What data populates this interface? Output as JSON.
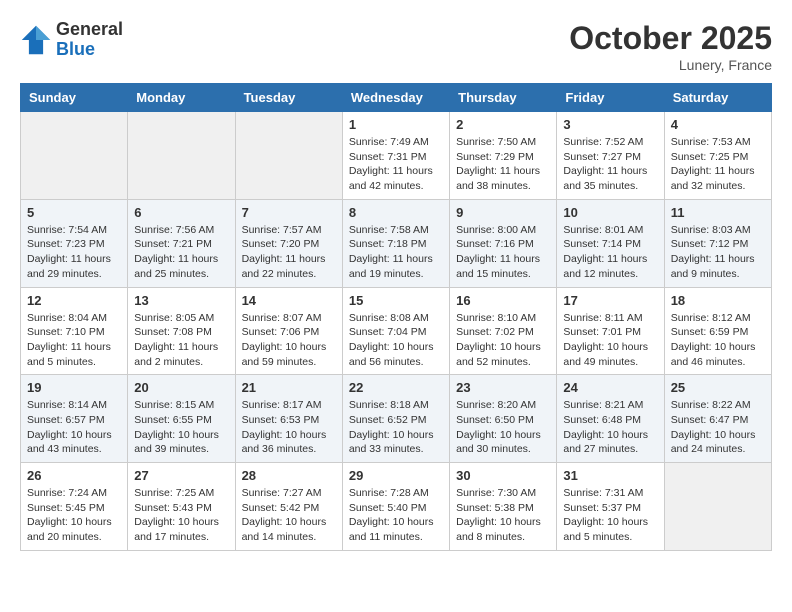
{
  "header": {
    "logo_general": "General",
    "logo_blue": "Blue",
    "month_title": "October 2025",
    "location": "Lunery, France"
  },
  "days_of_week": [
    "Sunday",
    "Monday",
    "Tuesday",
    "Wednesday",
    "Thursday",
    "Friday",
    "Saturday"
  ],
  "weeks": [
    [
      {
        "day": "",
        "info": ""
      },
      {
        "day": "",
        "info": ""
      },
      {
        "day": "",
        "info": ""
      },
      {
        "day": "1",
        "info": "Sunrise: 7:49 AM\nSunset: 7:31 PM\nDaylight: 11 hours\nand 42 minutes."
      },
      {
        "day": "2",
        "info": "Sunrise: 7:50 AM\nSunset: 7:29 PM\nDaylight: 11 hours\nand 38 minutes."
      },
      {
        "day": "3",
        "info": "Sunrise: 7:52 AM\nSunset: 7:27 PM\nDaylight: 11 hours\nand 35 minutes."
      },
      {
        "day": "4",
        "info": "Sunrise: 7:53 AM\nSunset: 7:25 PM\nDaylight: 11 hours\nand 32 minutes."
      }
    ],
    [
      {
        "day": "5",
        "info": "Sunrise: 7:54 AM\nSunset: 7:23 PM\nDaylight: 11 hours\nand 29 minutes."
      },
      {
        "day": "6",
        "info": "Sunrise: 7:56 AM\nSunset: 7:21 PM\nDaylight: 11 hours\nand 25 minutes."
      },
      {
        "day": "7",
        "info": "Sunrise: 7:57 AM\nSunset: 7:20 PM\nDaylight: 11 hours\nand 22 minutes."
      },
      {
        "day": "8",
        "info": "Sunrise: 7:58 AM\nSunset: 7:18 PM\nDaylight: 11 hours\nand 19 minutes."
      },
      {
        "day": "9",
        "info": "Sunrise: 8:00 AM\nSunset: 7:16 PM\nDaylight: 11 hours\nand 15 minutes."
      },
      {
        "day": "10",
        "info": "Sunrise: 8:01 AM\nSunset: 7:14 PM\nDaylight: 11 hours\nand 12 minutes."
      },
      {
        "day": "11",
        "info": "Sunrise: 8:03 AM\nSunset: 7:12 PM\nDaylight: 11 hours\nand 9 minutes."
      }
    ],
    [
      {
        "day": "12",
        "info": "Sunrise: 8:04 AM\nSunset: 7:10 PM\nDaylight: 11 hours\nand 5 minutes."
      },
      {
        "day": "13",
        "info": "Sunrise: 8:05 AM\nSunset: 7:08 PM\nDaylight: 11 hours\nand 2 minutes."
      },
      {
        "day": "14",
        "info": "Sunrise: 8:07 AM\nSunset: 7:06 PM\nDaylight: 10 hours\nand 59 minutes."
      },
      {
        "day": "15",
        "info": "Sunrise: 8:08 AM\nSunset: 7:04 PM\nDaylight: 10 hours\nand 56 minutes."
      },
      {
        "day": "16",
        "info": "Sunrise: 8:10 AM\nSunset: 7:02 PM\nDaylight: 10 hours\nand 52 minutes."
      },
      {
        "day": "17",
        "info": "Sunrise: 8:11 AM\nSunset: 7:01 PM\nDaylight: 10 hours\nand 49 minutes."
      },
      {
        "day": "18",
        "info": "Sunrise: 8:12 AM\nSunset: 6:59 PM\nDaylight: 10 hours\nand 46 minutes."
      }
    ],
    [
      {
        "day": "19",
        "info": "Sunrise: 8:14 AM\nSunset: 6:57 PM\nDaylight: 10 hours\nand 43 minutes."
      },
      {
        "day": "20",
        "info": "Sunrise: 8:15 AM\nSunset: 6:55 PM\nDaylight: 10 hours\nand 39 minutes."
      },
      {
        "day": "21",
        "info": "Sunrise: 8:17 AM\nSunset: 6:53 PM\nDaylight: 10 hours\nand 36 minutes."
      },
      {
        "day": "22",
        "info": "Sunrise: 8:18 AM\nSunset: 6:52 PM\nDaylight: 10 hours\nand 33 minutes."
      },
      {
        "day": "23",
        "info": "Sunrise: 8:20 AM\nSunset: 6:50 PM\nDaylight: 10 hours\nand 30 minutes."
      },
      {
        "day": "24",
        "info": "Sunrise: 8:21 AM\nSunset: 6:48 PM\nDaylight: 10 hours\nand 27 minutes."
      },
      {
        "day": "25",
        "info": "Sunrise: 8:22 AM\nSunset: 6:47 PM\nDaylight: 10 hours\nand 24 minutes."
      }
    ],
    [
      {
        "day": "26",
        "info": "Sunrise: 7:24 AM\nSunset: 5:45 PM\nDaylight: 10 hours\nand 20 minutes."
      },
      {
        "day": "27",
        "info": "Sunrise: 7:25 AM\nSunset: 5:43 PM\nDaylight: 10 hours\nand 17 minutes."
      },
      {
        "day": "28",
        "info": "Sunrise: 7:27 AM\nSunset: 5:42 PM\nDaylight: 10 hours\nand 14 minutes."
      },
      {
        "day": "29",
        "info": "Sunrise: 7:28 AM\nSunset: 5:40 PM\nDaylight: 10 hours\nand 11 minutes."
      },
      {
        "day": "30",
        "info": "Sunrise: 7:30 AM\nSunset: 5:38 PM\nDaylight: 10 hours\nand 8 minutes."
      },
      {
        "day": "31",
        "info": "Sunrise: 7:31 AM\nSunset: 5:37 PM\nDaylight: 10 hours\nand 5 minutes."
      },
      {
        "day": "",
        "info": ""
      }
    ]
  ]
}
